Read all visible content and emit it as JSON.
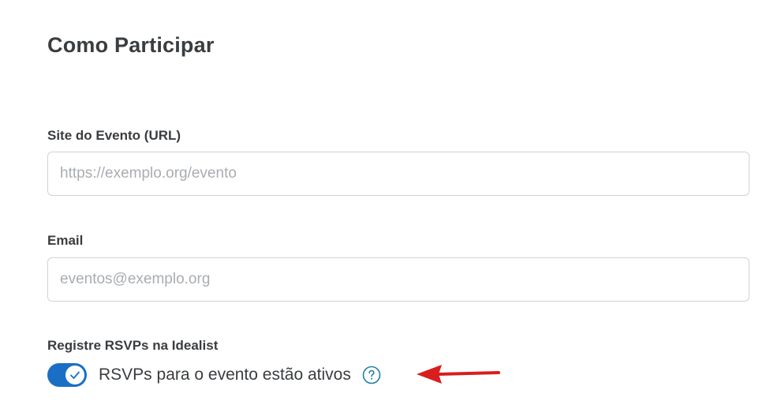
{
  "section": {
    "title": "Como Participar"
  },
  "fields": {
    "url": {
      "label": "Site do Evento (URL)",
      "value": "",
      "placeholder": "https://exemplo.org/evento"
    },
    "email": {
      "label": "Email",
      "value": "",
      "placeholder": "eventos@exemplo.org"
    }
  },
  "rsvp": {
    "label": "Registre RSVPs na Idealist",
    "toggle_on": true,
    "toggle_text": "RSVPs para o evento estão ativos",
    "toggle_icon": "check-icon",
    "help_icon": "question-mark-icon"
  },
  "annotation": {
    "arrow_icon": "arrow-left-icon"
  },
  "colors": {
    "toggle_on": "#1a6fc4",
    "help_icon": "#1f7fa8",
    "arrow": "#d81e1e"
  }
}
